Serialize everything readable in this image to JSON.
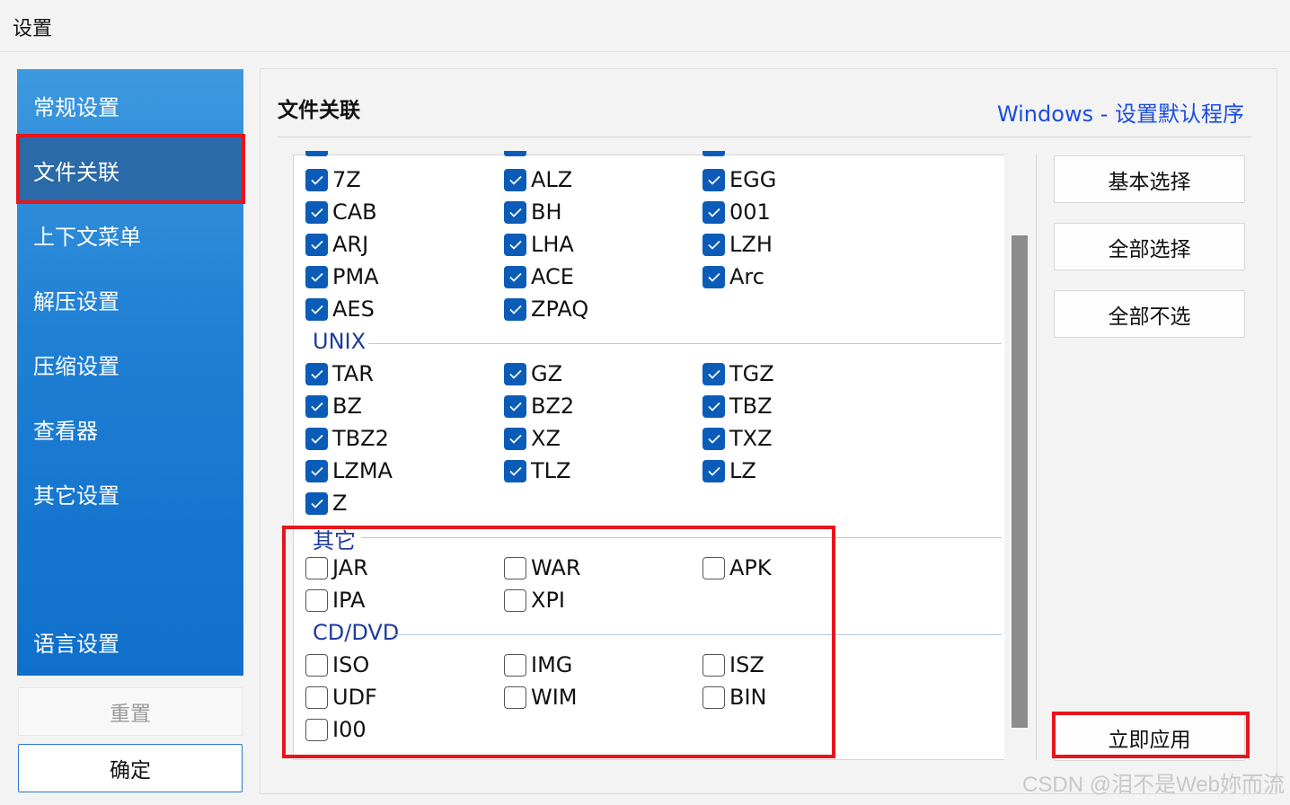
{
  "window": {
    "title": "设置"
  },
  "sidebar": {
    "items": [
      {
        "label": "常规设置",
        "active": false
      },
      {
        "label": "文件关联",
        "active": true
      },
      {
        "label": "上下文菜单",
        "active": false
      },
      {
        "label": "解压设置",
        "active": false
      },
      {
        "label": "压缩设置",
        "active": false
      },
      {
        "label": "查看器",
        "active": false
      },
      {
        "label": "其它设置",
        "active": false
      },
      {
        "label": "语言设置",
        "active": false
      }
    ],
    "reset_label": "重置",
    "ok_label": "确定"
  },
  "main": {
    "title": "文件关联",
    "default_link": "Windows - 设置默认程序"
  },
  "groups": [
    {
      "name": "",
      "formats": [
        {
          "label": "7Z",
          "checked": true
        },
        {
          "label": "ALZ",
          "checked": true
        },
        {
          "label": "EGG",
          "checked": true
        },
        {
          "label": "CAB",
          "checked": true
        },
        {
          "label": "BH",
          "checked": true
        },
        {
          "label": "001",
          "checked": true
        },
        {
          "label": "ARJ",
          "checked": true
        },
        {
          "label": "LHA",
          "checked": true
        },
        {
          "label": "LZH",
          "checked": true
        },
        {
          "label": "PMA",
          "checked": true
        },
        {
          "label": "ACE",
          "checked": true
        },
        {
          "label": "Arc",
          "checked": true
        },
        {
          "label": "AES",
          "checked": true
        },
        {
          "label": "ZPAQ",
          "checked": true
        }
      ]
    },
    {
      "name": "UNIX",
      "formats": [
        {
          "label": "TAR",
          "checked": true
        },
        {
          "label": "GZ",
          "checked": true
        },
        {
          "label": "TGZ",
          "checked": true
        },
        {
          "label": "BZ",
          "checked": true
        },
        {
          "label": "BZ2",
          "checked": true
        },
        {
          "label": "TBZ",
          "checked": true
        },
        {
          "label": "TBZ2",
          "checked": true
        },
        {
          "label": "XZ",
          "checked": true
        },
        {
          "label": "TXZ",
          "checked": true
        },
        {
          "label": "LZMA",
          "checked": true
        },
        {
          "label": "TLZ",
          "checked": true
        },
        {
          "label": "LZ",
          "checked": true
        },
        {
          "label": "Z",
          "checked": true
        }
      ]
    },
    {
      "name": "其它",
      "formats": [
        {
          "label": "JAR",
          "checked": false
        },
        {
          "label": "WAR",
          "checked": false
        },
        {
          "label": "APK",
          "checked": false
        },
        {
          "label": "IPA",
          "checked": false
        },
        {
          "label": "XPI",
          "checked": false
        }
      ]
    },
    {
      "name": "CD/DVD",
      "formats": [
        {
          "label": "ISO",
          "checked": false
        },
        {
          "label": "IMG",
          "checked": false
        },
        {
          "label": "ISZ",
          "checked": false
        },
        {
          "label": "UDF",
          "checked": false
        },
        {
          "label": "WIM",
          "checked": false
        },
        {
          "label": "BIN",
          "checked": false
        },
        {
          "label": "I00",
          "checked": false
        }
      ]
    }
  ],
  "actions": {
    "basic_select": "基本选择",
    "select_all": "全部选择",
    "select_none": "全部不选",
    "apply_now": "立即应用"
  },
  "watermark": "CSDN @泪不是Web妳而流",
  "colors": {
    "sidebar_blue": "#1f7fd4",
    "sidebar_active": "#2b6aa8",
    "checkbox_checked": "#0b5cb8",
    "link_blue": "#1a4de0",
    "highlight_red": "#e8151b"
  }
}
